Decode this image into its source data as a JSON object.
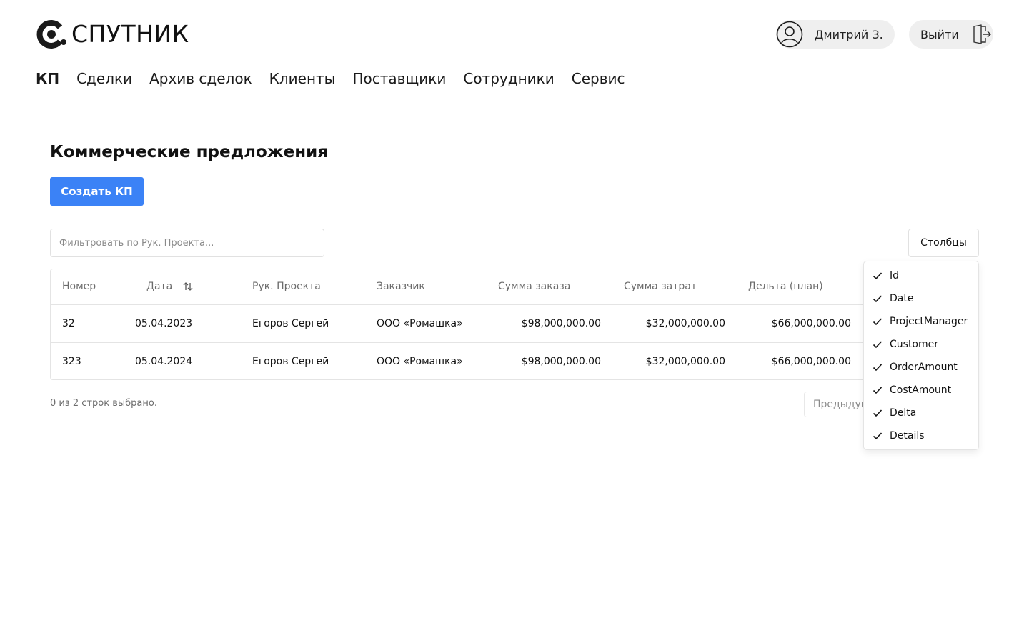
{
  "header": {
    "logo_text": "СПУТНИК",
    "user_name": "Дмитрий З.",
    "logout_label": "Выйти"
  },
  "nav": {
    "items": [
      {
        "label": "КП",
        "active": true
      },
      {
        "label": "Сделки",
        "active": false
      },
      {
        "label": "Архив сделок",
        "active": false
      },
      {
        "label": "Клиенты",
        "active": false
      },
      {
        "label": "Поставщики",
        "active": false
      },
      {
        "label": "Сотрудники",
        "active": false
      },
      {
        "label": "Сервис",
        "active": false
      }
    ]
  },
  "page": {
    "title": "Коммерческие предложения",
    "create_button": "Создать КП",
    "filter_placeholder": "Фильтровать по Рук. Проекта...",
    "columns_button": "Столбцы"
  },
  "table": {
    "columns": [
      "Номер",
      "Дата",
      "Рук. Проекта",
      "Заказчик",
      "Сумма заказа",
      "Сумма затрат",
      "Дельта (план)"
    ],
    "rows": [
      [
        "32",
        "05.04.2023",
        "Егоров Сергей",
        "ООО «Ромашка»",
        "$98,000,000.00",
        "$32,000,000.00",
        "$66,000,000.00"
      ],
      [
        "323",
        "05.04.2024",
        "Егоров Сергей",
        "ООО «Ромашка»",
        "$98,000,000.00",
        "$32,000,000.00",
        "$66,000,000.00"
      ]
    ]
  },
  "footer": {
    "selected_info": "0 из 2 строк выбрано.",
    "prev_button": "Предыдущая"
  },
  "columns_menu": {
    "items": [
      "Id",
      "Date",
      "ProjectManager",
      "Customer",
      "OrderAmount",
      "CostAmount",
      "Delta",
      "Details"
    ],
    "checked": [
      true,
      true,
      true,
      true,
      true,
      true,
      true,
      true
    ]
  },
  "colors": {
    "primary": "#3b82f6",
    "pill_bg": "#efefef",
    "border": "#e4e4e4"
  }
}
